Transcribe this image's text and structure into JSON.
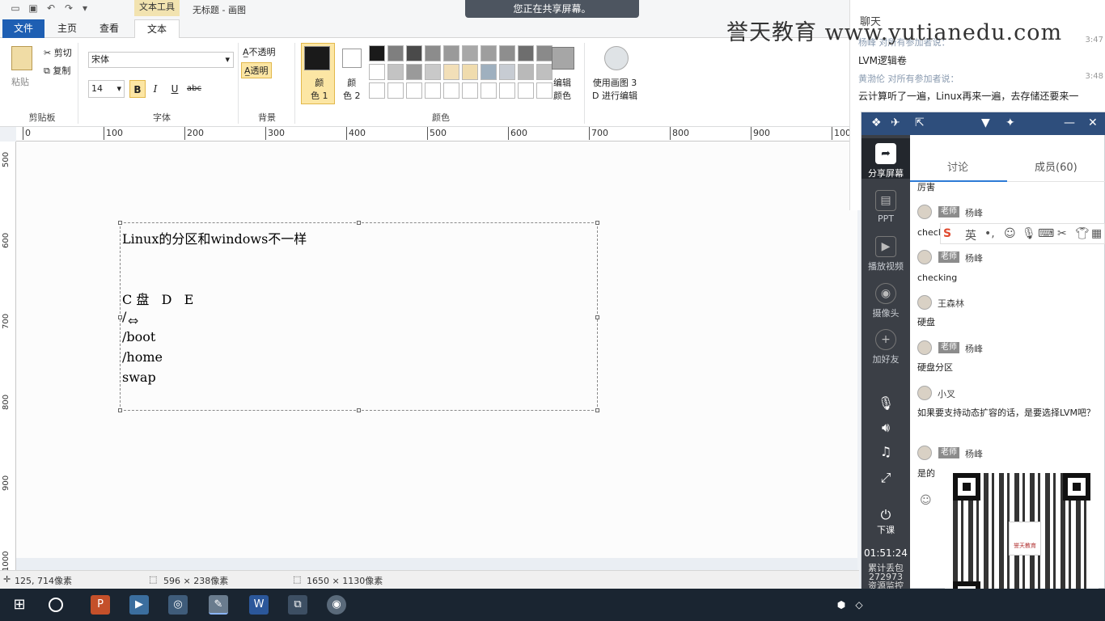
{
  "app": {
    "context_tab_label": "文本工具",
    "window_title": "无标题 - 画图",
    "share_banner": "您正在共享屏幕。"
  },
  "tabs": [
    {
      "label": "文件"
    },
    {
      "label": "主页"
    },
    {
      "label": "查看"
    },
    {
      "label": "文本"
    }
  ],
  "ribbon": {
    "clipboard": {
      "paste": "粘贴",
      "cut": "剪切",
      "copy": "复制",
      "group": "剪贴板"
    },
    "font": {
      "family": "宋体",
      "size": "14",
      "bold": "B",
      "italic": "I",
      "underline": "U",
      "strike": "abc",
      "group": "字体"
    },
    "background": {
      "opaque": "不透明",
      "transparent": "透明",
      "group": "背景"
    },
    "colors": {
      "color1": "颜色 1",
      "color1_line1": "颜",
      "color1_line2": "色 1",
      "color2_line1": "颜",
      "color2_line2": "色 2",
      "edit_line1": "编辑",
      "edit_line2": "颜色",
      "group": "颜色",
      "color1_value": "#1a1a1a",
      "palette": [
        "#1a1a1a",
        "#7f7f7f",
        "#4a4a4a",
        "#8c8c8c",
        "#9a9a9a",
        "#a8a8a8",
        "#9e9e9e",
        "#8e8e8e",
        "#6e6e6e",
        "#8a8a8a",
        "#ffffff",
        "#c3c3c3",
        "#9a9a9a",
        "#c9c9c9",
        "#f2dfb8",
        "#f0dcae",
        "#9fb0bf",
        "#c7ccd3",
        "#b9b9b9",
        "#bfbfbf",
        "#ffffff",
        "#ffffff",
        "#ffffff",
        "#ffffff",
        "#ffffff",
        "#ffffff",
        "#ffffff",
        "#ffffff",
        "#ffffff",
        "#ffffff"
      ]
    },
    "paint3d": {
      "line1": "使用画图 3",
      "line2": "D 进行编辑"
    }
  },
  "ruler": {
    "h_ticks": [
      "0",
      "100",
      "200",
      "300",
      "400",
      "500",
      "600",
      "700",
      "800",
      "900",
      "100"
    ],
    "v_ticks": [
      "500",
      "600",
      "700",
      "800",
      "900",
      "1000"
    ]
  },
  "canvas_text": {
    "line1": "Linux的分区和windows不一样",
    "line2": "C 盘   D   E",
    "line3": "/",
    "line4": "/boot",
    "line5": "/home",
    "line6": "swap"
  },
  "status": {
    "cursor_pos": "125, 714像素",
    "selection_size": "596 × 238像素",
    "image_size": "1650 × 1130像素"
  },
  "watermark": "誉天教育 www.yutianedu.com",
  "chat_top": {
    "title": "聊天",
    "meta1": "杨峰 对所有参加者说：",
    "time1": "3:47",
    "msg1": "LVM逻辑卷",
    "meta2": "黄渤伦 对所有参加者说：",
    "time2": "3:48",
    "msg2": "云计算听了一遍，Linux再来一遍，去存储还要来一"
  },
  "classroom": {
    "sidebar": {
      "share": "分享屏幕",
      "ppt": "PPT",
      "video": "播放视频",
      "camera": "摄像头",
      "add_friend": "加好友",
      "end_class": "下课",
      "time": "01:51:24",
      "loss_label": "累计丢包",
      "loss_value": "272973",
      "monitor": "资源监控"
    },
    "tabs": {
      "discussion": "讨论",
      "members": "成员(60)"
    },
    "messages": [
      {
        "text": "厉害"
      },
      {
        "badge": "老师",
        "user": "杨峰",
        "text": "checki"
      },
      {
        "badge": "老师",
        "user": "杨峰",
        "text": "checking"
      },
      {
        "user": "王森林",
        "text": "硬盘"
      },
      {
        "badge": "老师",
        "user": "杨峰",
        "text": "硬盘分区"
      },
      {
        "user": "小叉",
        "text": "如果要支持动态扩容的话，是要选择LVM吧？"
      },
      {
        "badge": "老师",
        "user": "杨峰",
        "text": "是的"
      }
    ],
    "ime_lang": "英",
    "qr_brand": "誉天教育"
  }
}
